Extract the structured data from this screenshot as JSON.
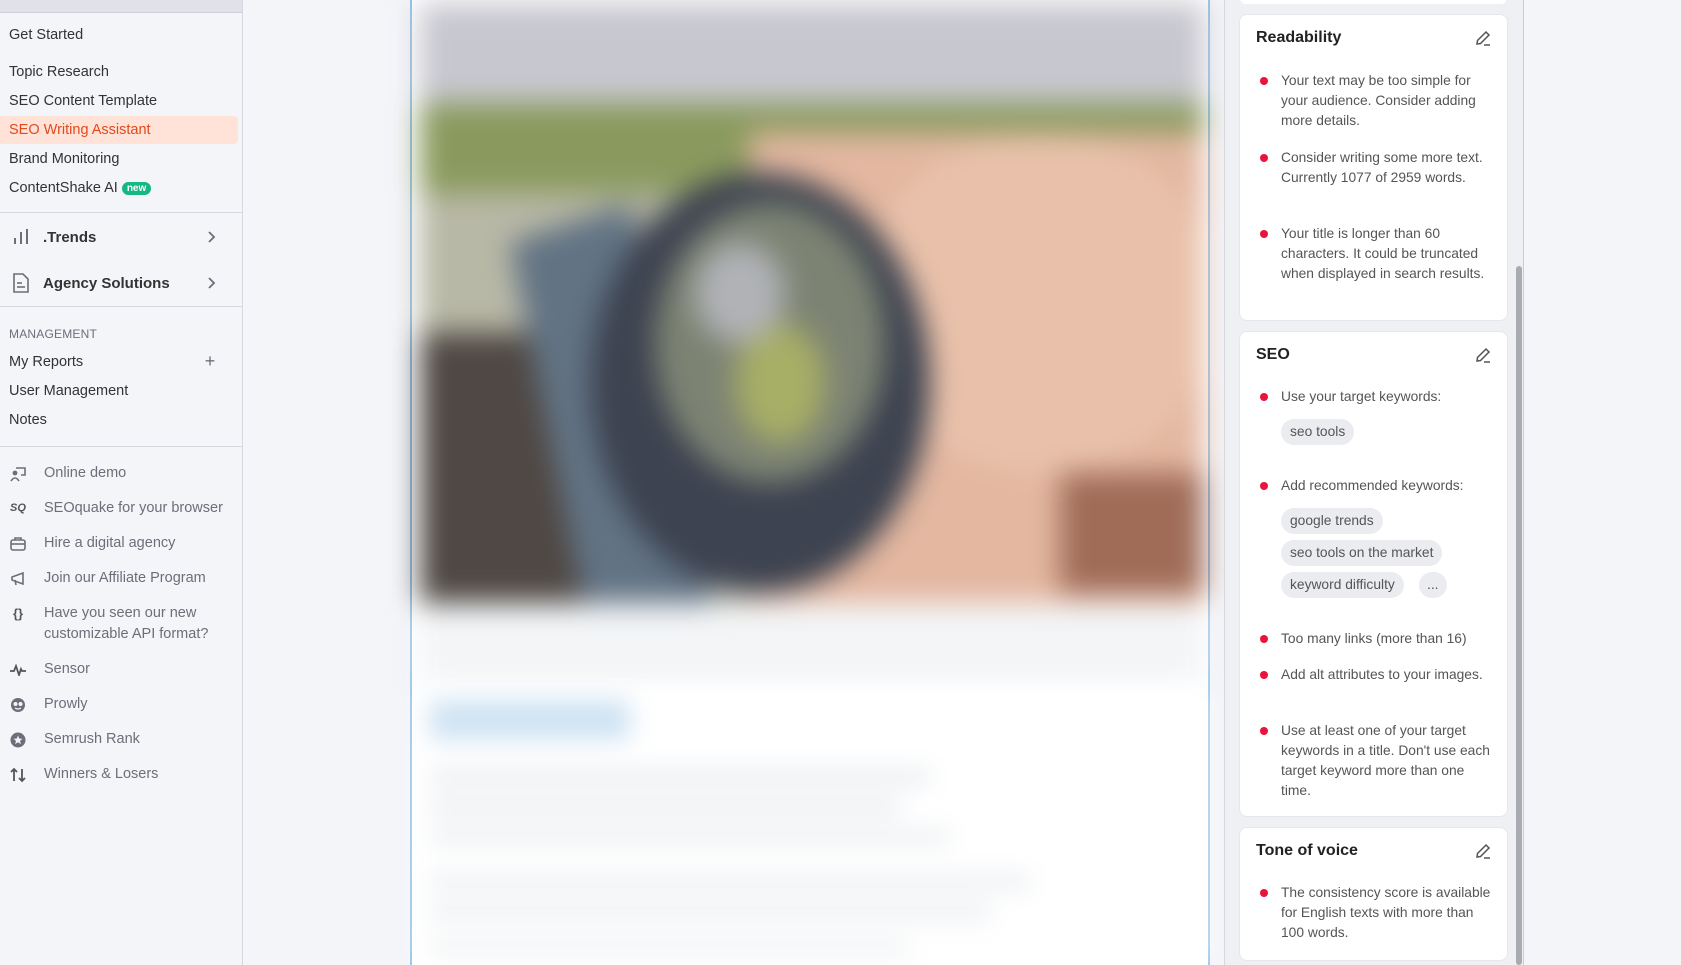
{
  "sidebar": {
    "top_items": [
      {
        "label": "Get Started"
      },
      {
        "label": "Topic Research"
      },
      {
        "label": "SEO Content Template"
      },
      {
        "label": "SEO Writing Assistant",
        "active": true
      },
      {
        "label": "Brand Monitoring"
      },
      {
        "label": "ContentShake AI",
        "badge": "new"
      }
    ],
    "groups": [
      {
        "label": ".Trends",
        "icon": "bar-chart-icon"
      },
      {
        "label": "Agency Solutions",
        "icon": "document-icon"
      }
    ],
    "management": {
      "heading": "MANAGEMENT",
      "items": [
        {
          "label": "My Reports",
          "action": "+"
        },
        {
          "label": "User Management"
        },
        {
          "label": "Notes"
        }
      ]
    },
    "extras": [
      {
        "label": "Online demo",
        "icon": "presenter-icon"
      },
      {
        "label": "SEOquake for your browser",
        "icon": "seoquake-icon",
        "glyph": "SQ"
      },
      {
        "label": "Hire a digital agency",
        "icon": "briefcase-icon"
      },
      {
        "label": "Join our Affiliate Program",
        "icon": "megaphone-icon"
      },
      {
        "label": "Have you seen our new customizable API format?",
        "icon": "braces-icon",
        "glyph": "{}"
      },
      {
        "label": "Sensor",
        "icon": "pulse-icon"
      },
      {
        "label": "Prowly",
        "icon": "prowly-icon"
      },
      {
        "label": "Semrush Rank",
        "icon": "star-circle-icon"
      },
      {
        "label": "Winners & Losers",
        "icon": "up-down-arrows-icon",
        "glyph": "⇅"
      }
    ]
  },
  "editor": {
    "content_state": "blurred image of a smartwatch on a wrist followed by blurred text"
  },
  "panel": {
    "colors": {
      "alert_dot": "#e8143c",
      "chip_bg": "#ebecf0"
    },
    "readability": {
      "title": "Readability",
      "tips": [
        "Your text may be too simple for your audience. Consider adding more details.",
        "Consider writing some more text. Currently 1077 of 2959 words.",
        "Your title is longer than 60 characters. It could be truncated when displayed in search results."
      ]
    },
    "seo": {
      "title": "SEO",
      "target_keywords_label": "Use your target keywords:",
      "target_keywords": [
        "seo tools"
      ],
      "recommended_keywords_label": "Add recommended keywords:",
      "recommended_keywords": [
        "google trends",
        "seo tools on the market",
        "keyword difficulty"
      ],
      "more_label": "...",
      "tips": [
        "Too many links (more than 16)",
        "Add alt attributes to your images.",
        "Use at least one of your target keywords in a title. Don't use each target keyword more than one time."
      ]
    },
    "tone_of_voice": {
      "title": "Tone of voice",
      "tips": [
        "The consistency score is available for English texts with more than 100 words."
      ]
    }
  }
}
